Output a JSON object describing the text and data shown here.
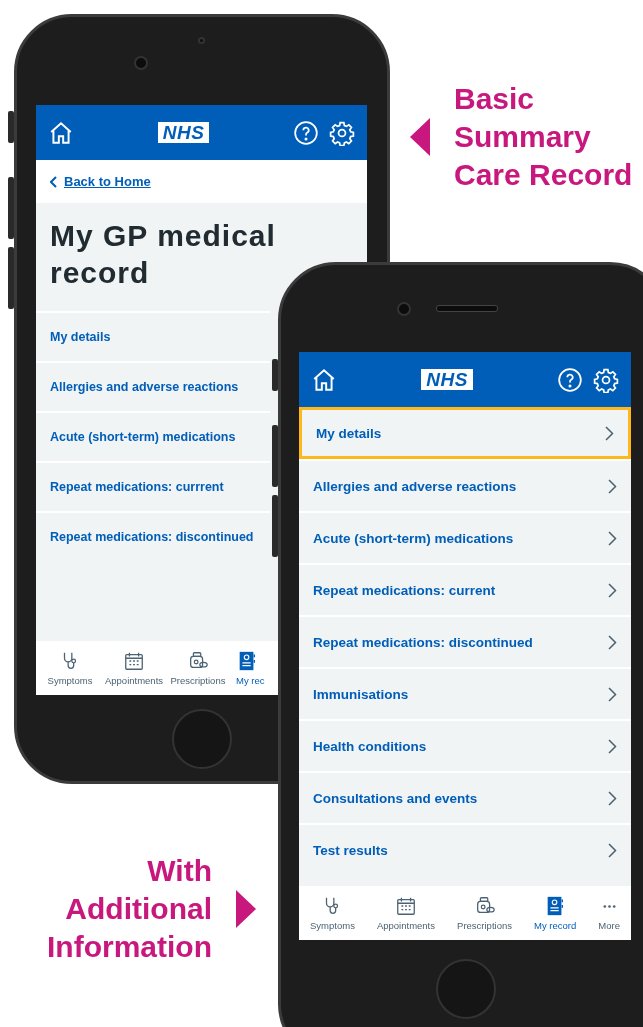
{
  "phones": [
    {
      "logo": "NHS",
      "back_link": "Back to Home",
      "title": "My GP medical record",
      "menu": [
        {
          "label": "My details",
          "focused": false
        },
        {
          "label": "Allergies and adverse reactions",
          "focused": false
        },
        {
          "label": "Acute (short-term) medications",
          "focused": false
        },
        {
          "label": "Repeat medications: currrent",
          "focused": false
        },
        {
          "label": "Repeat medications: discontinued",
          "focused": false
        }
      ],
      "tabs": [
        {
          "label": "Symptoms",
          "kind": "stethoscope",
          "selected": false
        },
        {
          "label": "Appointments",
          "kind": "calendar",
          "selected": false
        },
        {
          "label": "Prescriptions",
          "kind": "prescription",
          "selected": false
        },
        {
          "label": "My rec",
          "kind": "record",
          "selected": true
        }
      ]
    },
    {
      "logo": "NHS",
      "menu": [
        {
          "label": "My details",
          "focused": true
        },
        {
          "label": "Allergies and adverse reactions",
          "focused": false
        },
        {
          "label": "Acute (short-term) medications",
          "focused": false
        },
        {
          "label": "Repeat medications: current",
          "focused": false
        },
        {
          "label": "Repeat medications: discontinued",
          "focused": false
        },
        {
          "label": "Immunisations",
          "focused": false
        },
        {
          "label": "Health conditions",
          "focused": false
        },
        {
          "label": "Consultations and events",
          "focused": false
        },
        {
          "label": "Test results",
          "focused": false
        }
      ],
      "tabs": [
        {
          "label": "Symptoms",
          "kind": "stethoscope",
          "selected": false
        },
        {
          "label": "Appointments",
          "kind": "calendar",
          "selected": false
        },
        {
          "label": "Prescriptions",
          "kind": "prescription",
          "selected": false
        },
        {
          "label": "My record",
          "kind": "record",
          "selected": true
        },
        {
          "label": "More",
          "kind": "more",
          "selected": false
        }
      ]
    }
  ],
  "callouts": [
    {
      "lines": [
        "Basic",
        "Summary",
        "Care Record"
      ],
      "kind": "left"
    },
    {
      "lines": [
        "With",
        "Additional",
        "Information"
      ],
      "kind": "right"
    }
  ]
}
